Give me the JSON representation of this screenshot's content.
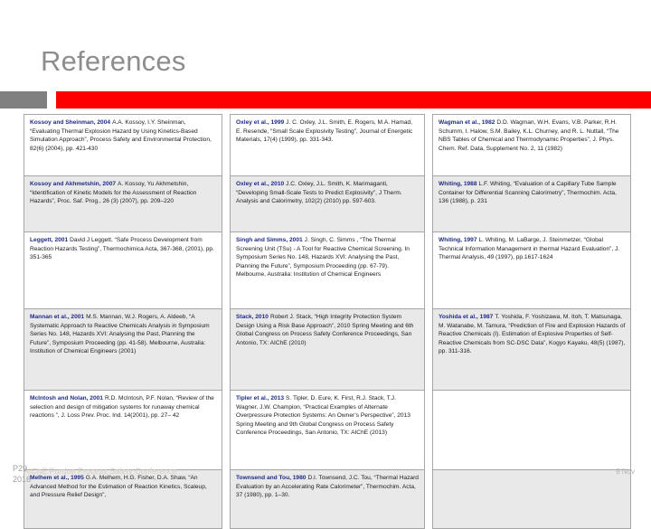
{
  "slide": {
    "title": "References",
    "accent_color": "#ff0000",
    "block_color": "#808080",
    "title_color": "#8d8d8d"
  },
  "footer": {
    "page_number": "P29",
    "year": "2016",
    "date": "9 Nov",
    "watermark": "AIChE Purdue Process Safety Conference"
  },
  "references": {
    "columns": [
      {
        "entries": [
          {
            "citation": "Kossoy and Sheinman, 2004",
            "text": "A.A. Kossoy, I.Y. Sheinman, “Evaluating Thermal Explosion Hazard by Using Kinetics-Based Simulation Approach”, Process Safety and Environmental Protection, 82(6) (2004), pp. 421-430"
          },
          {
            "citation": "Kossoy and Akhmetshin, 2007",
            "text": "A. Kossoy, Yu Akhmetshin, “Identification of Kinetic Models for the Assessment of Reaction Hazards”, Proc. Saf. Prog., 26 (3) (2007), pp. 209–220"
          },
          {
            "citation": "Leggett, 2001",
            "text": "David J Leggett, “Safe Process Development from Reaction Hazards Testing”, Thermochimica Acta, 367-368, (2001), pp. 351-365"
          },
          {
            "citation": "Mannan et al., 2001",
            "text": "M.S. Mannan, W.J. Rogers, A. Aldeeb, “A Systematic Approach to Reactive Chemicals Analysis in Symposium Series No. 148, Hazards XVI: Analysing the Past, Planning the Future”, Symposium Proceeding (pp. 41-58). Melbourne, Australia: Institution of Chemical Engineers (2001)"
          },
          {
            "citation": "McIntosh and Nolan, 2001",
            "text": "R.D. McIntosh, P.F. Nolan, “Review of the selection and design of mitigation systems for runaway chemical reactions ”, J. Loss Prev. Proc. Ind. 14(2001), pp. 27– 42"
          },
          {
            "citation": "Melhem et al., 1995",
            "text": "G.A. Melhem, H.G. Fisher, D.A. Shaw, “An Advanced Method for the Estimation of Reaction Kinetics, Scaleup, and Pressure Relief Design”,"
          }
        ]
      },
      {
        "entries": [
          {
            "citation": "Oxley et al., 1999",
            "text": "J. C. Oxley, J.L. Smith, E. Rogers, M.A. Hamad, E. Resende, “Small Scale Explosivity Testing”, Journal of Energetic Materials, 17(4) (1999), pp. 331-343."
          },
          {
            "citation": "Oxley et al., 2010",
            "text": "J.C. Oxley, J.L. Smith, K. Marimaganti, “Developing Small-Scale Tests to Predict Explosivity”, J Therm. Analysis and Calorimetry, 102(2) (2010) pp. 597-603."
          },
          {
            "citation": "Singh and Simms, 2001",
            "text": "J. Singh, C. Simms , “The Thermal Screening Unit (TSu) - A Tool for Reactive Chemical Screening. In Symposium Series No. 148, Hazards XVI: Analysing the Past, Planning the Future”, Symposium Proceeding (pp. 67-79). Melbourne, Australia: Institution of Chemical Engineers"
          },
          {
            "citation": "Stack, 2010",
            "text": "Robert J. Stack, “High Integrity Protection System Design Using a Risk Base Approach”, 2010 Spring Meeting and 6th Global Congress on Process Safety Conference Proceedings, San Antonio, TX:  AIChE (2010)"
          },
          {
            "citation": "Tipler et al., 2013",
            "text": "S. Tipler, D. Eure, K. First, R.J. Stack, T.J. Wagner, J.W. Champion, “Practical Examples of Alternate Overpressure Protection Systems:  An Owner’s Perspective”, 2013 Spring Meeting and 9th Global Congress on Process Safety Conference Proceedings, San Antonio, TX:  AIChE (2013)"
          },
          {
            "citation": "Townsend and Tou, 1980",
            "text": "D.I. Townsend, J.C. Tou, “Thermal Hazard Evaluation by an Accelerating Rate Calorimeter”, Thermochim. Acta, 37 (1980), pp. 1–30."
          }
        ]
      },
      {
        "entries": [
          {
            "citation": "Wagman et al., 1982",
            "text": "D.D. Wagman, W.H. Evans, V.B. Parker, R.H. Schumm, I. Halow, S.M. Bailey, K.L. Churney, and R. L. Nuttall, “The NBS Tables of Chemical and Thermodynamic Properties”, J. Phys. Chem. Ref. Data, Supplement No. 2, 11 (1982)"
          },
          {
            "citation": "Whiting, 1988",
            "text": "L.F. Whiting, “Evaluation of a Capillary Tube Sample Container for Differential Scanning Calorimetry”, Thermochim. Acta, 136 (1988), p. 231"
          },
          {
            "citation": "Whiting, 1997",
            "text": "L. Whiting, M. LaBarge, J. Steinmetzer, “Global Technical Information Management in thermal Hazard Evaluation”, J. Thermal Analysis, 49 (1997), pp.1617-1624"
          },
          {
            "citation": "Yoshida et al., 1987",
            "text": "T. Yoshida, F. Yoshizawa, M. Itoh, T. Matsunaga, M. Watanabe, M. Tamura, “Prediction of Fire and Explosion Hazards of Reactive Chemicals (I). Estimation of Explosive Properties of Self-Reactive Chemicals from SC-DSC Data”,  Kogyo Kayaku, 48(5) (1987), pp. 311-316."
          },
          {
            "citation": "",
            "text": ""
          },
          {
            "citation": "",
            "text": ""
          }
        ]
      }
    ]
  }
}
